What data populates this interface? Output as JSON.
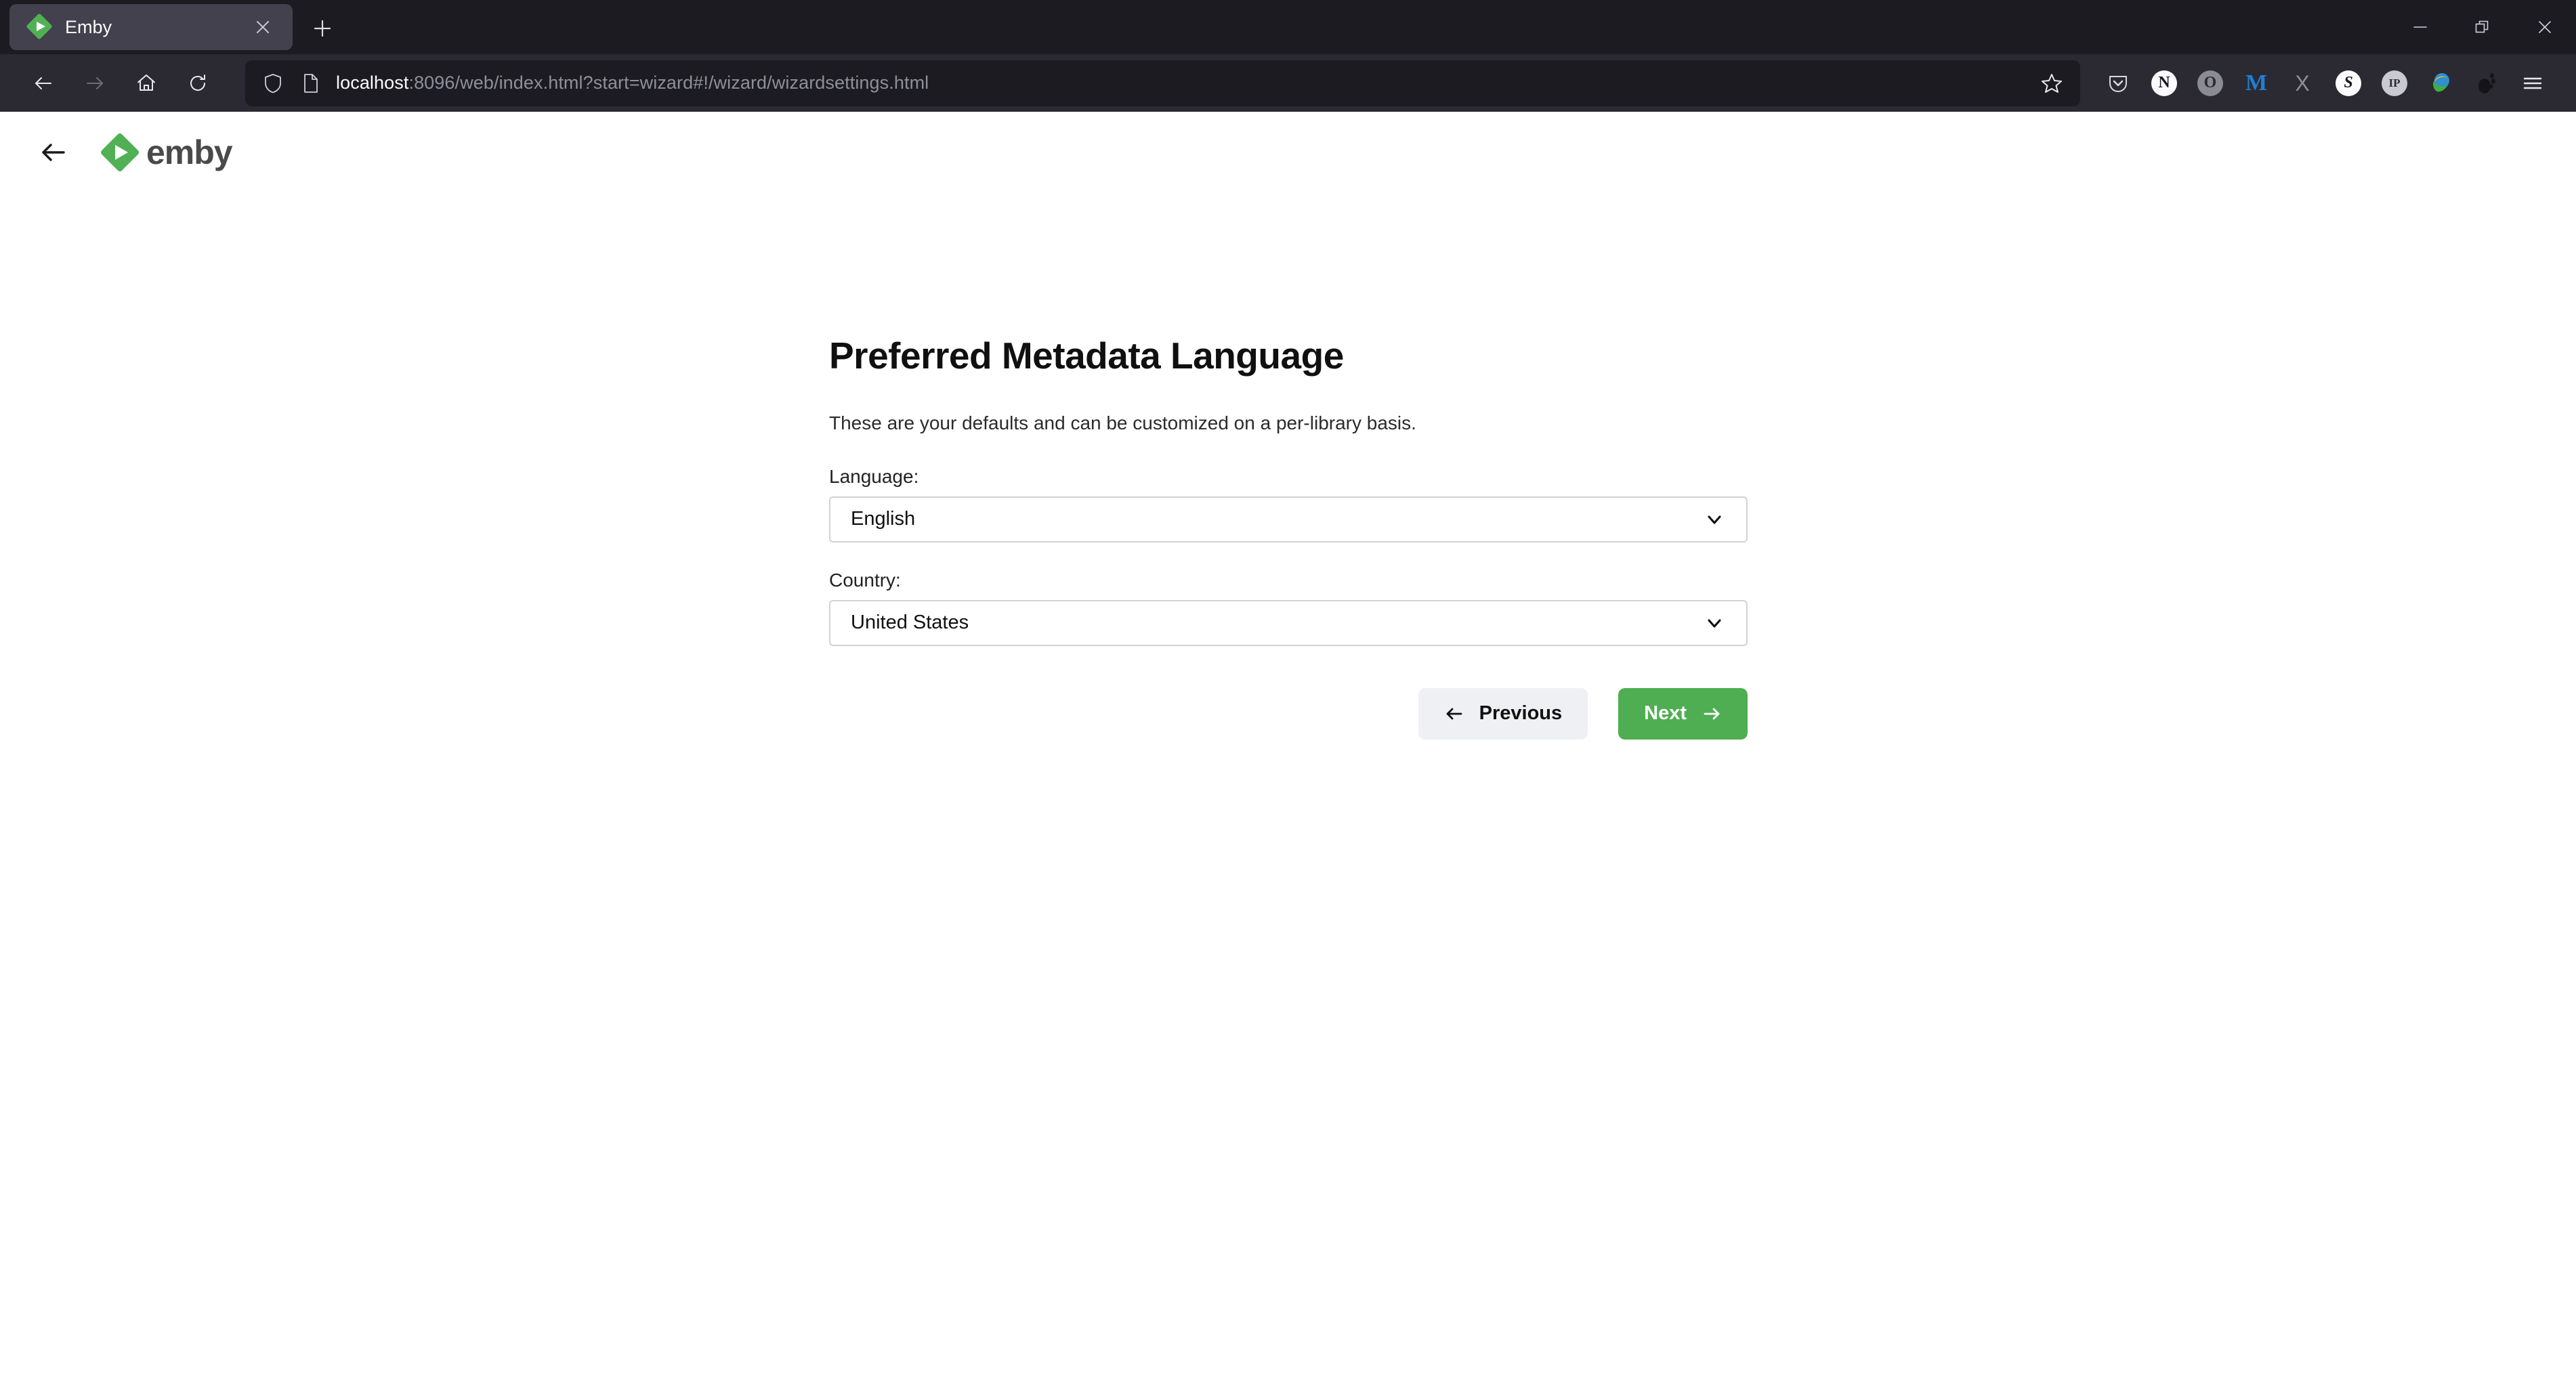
{
  "browser": {
    "tab": {
      "title": "Emby",
      "favicon": "emby-diamond-play-icon",
      "close_label": "×"
    },
    "new_tab_label": "+",
    "window_controls": {
      "minimize": "minimize-icon",
      "restore": "restore-icon",
      "close": "close-icon"
    },
    "nav": {
      "back": "back-arrow-icon",
      "forward": "forward-arrow-icon",
      "home": "home-icon",
      "reload": "reload-icon"
    },
    "url": {
      "host": "localhost",
      "path": ":8096/web/index.html?start=wizard#!/wizard/wizardsettings.html",
      "full": "localhost:8096/web/index.html?start=wizard#!/wizard/wizardsettings.html",
      "shield_icon": "shield-icon",
      "page_icon": "page-document-icon",
      "bookmark_icon": "star-outline-icon"
    },
    "extensions": [
      {
        "name": "pocket-icon",
        "glyph": "⌄",
        "color": "#d8d8de",
        "kind": "shield"
      },
      {
        "name": "extension-n-icon",
        "glyph": "N",
        "color": "#ffffff",
        "kind": "circle-light"
      },
      {
        "name": "extension-o-icon",
        "glyph": "O",
        "color": "#8f8f96",
        "kind": "circle-gray"
      },
      {
        "name": "malwarebytes-icon",
        "glyph": "M",
        "color": "#1f7fd4",
        "kind": "letter"
      },
      {
        "name": "extension-x-icon",
        "glyph": "X",
        "color": "#8e8e95",
        "kind": "letter"
      },
      {
        "name": "extension-s-icon",
        "glyph": "S",
        "color": "#ffffff",
        "kind": "circle-light"
      },
      {
        "name": "ip-lookup-icon",
        "glyph": "IP",
        "color": "#cfcfd6",
        "kind": "circle-ip"
      },
      {
        "name": "download-manager-icon",
        "glyph": "",
        "color": "#3aa33a",
        "kind": "globe"
      },
      {
        "name": "gnome-foot-icon",
        "glyph": "",
        "color": "#111111",
        "kind": "foot"
      }
    ],
    "menu_icon": "hamburger-menu-icon"
  },
  "page": {
    "back_icon": "back-arrow-icon",
    "logo": {
      "mark": "emby-diamond-play-icon",
      "wordmark": "emby"
    },
    "title": "Preferred Metadata Language",
    "subtitle": "These are your defaults and can be customized on a per-library basis.",
    "fields": [
      {
        "label": "Language:",
        "value": "English",
        "chevron": "chevron-down-icon"
      },
      {
        "label": "Country:",
        "value": "United States",
        "chevron": "chevron-down-icon"
      }
    ],
    "buttons": {
      "previous": {
        "label": "Previous",
        "icon": "arrow-left-icon"
      },
      "next": {
        "label": "Next",
        "icon": "arrow-right-icon"
      }
    },
    "colors": {
      "accent_green": "#4fae51",
      "previous_bg": "#eff0f3",
      "title": "#101010"
    }
  }
}
